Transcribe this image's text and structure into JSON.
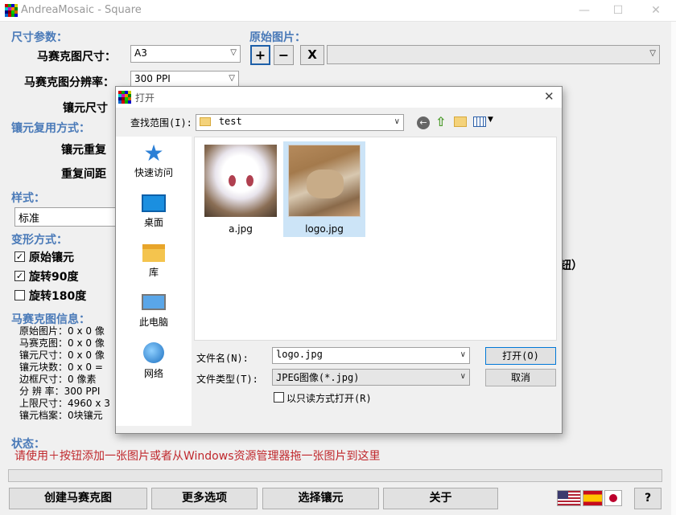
{
  "window": {
    "title": "AndreaMosaic - Square"
  },
  "left": {
    "size_params": "尺寸参数：",
    "mosaic_size_label": "马赛克图尺寸：",
    "mosaic_size_value": "A3",
    "resolution_label": "马赛克图分辨率：",
    "resolution_value": "300 PPI",
    "tile_size_label": "镶元尺寸",
    "reuse_section": "镶元复用方式：",
    "tile_repeat_label": "镶元重复",
    "repeat_spacing_label": "重复间距",
    "style_section": "样式：",
    "style_value": "标准",
    "transform_section": "变形方式：",
    "original_tile": "原始镶元",
    "rotate90": "旋转90度",
    "rotate180": "旋转180度",
    "info_section": "马赛克图信息：",
    "info_lines": [
      "原始图片：0 x 0 像",
      "马赛克图：0 x 0 像",
      "镶元尺寸：0 x 0 像",
      "镶元块数：0 x 0 =",
      "边框尺寸：0 像素",
      "分 辨 率：300 PPI",
      "上限尺寸：4960 x 3",
      "镶元档案：0块镶元"
    ]
  },
  "right": {
    "original_section": "原始图片：",
    "add_label": "+",
    "remove_label": "−",
    "clear_label": "X",
    "truncated_text": "钮）"
  },
  "status": {
    "label": "状态：",
    "message": "请使用＋按钮添加一张图片或者从Windows资源管理器拖一张图片到这里"
  },
  "bottom_buttons": {
    "create": "创建马赛克图",
    "more": "更多选项",
    "select_tiles": "选择镶元",
    "about": "关于",
    "help": "?"
  },
  "dialog": {
    "title": "打开",
    "lookin_label": "查找范围(I):",
    "lookin_value": "test",
    "places": [
      "快速访问",
      "桌面",
      "库",
      "此电脑",
      "网络"
    ],
    "files": [
      {
        "name": "a.jpg",
        "selected": false
      },
      {
        "name": "logo.jpg",
        "selected": true
      }
    ],
    "filename_label": "文件名(N):",
    "filename_value": "logo.jpg",
    "filetype_label": "文件类型(T):",
    "filetype_value": "JPEG图像(*.jpg)",
    "readonly_label": "以只读方式打开(R)",
    "open_button": "打开(O)",
    "cancel_button": "取消"
  },
  "colors": {
    "section_blue": "#4a7ab8",
    "status_red": "#c0282d",
    "selection": "#cce4f7"
  }
}
